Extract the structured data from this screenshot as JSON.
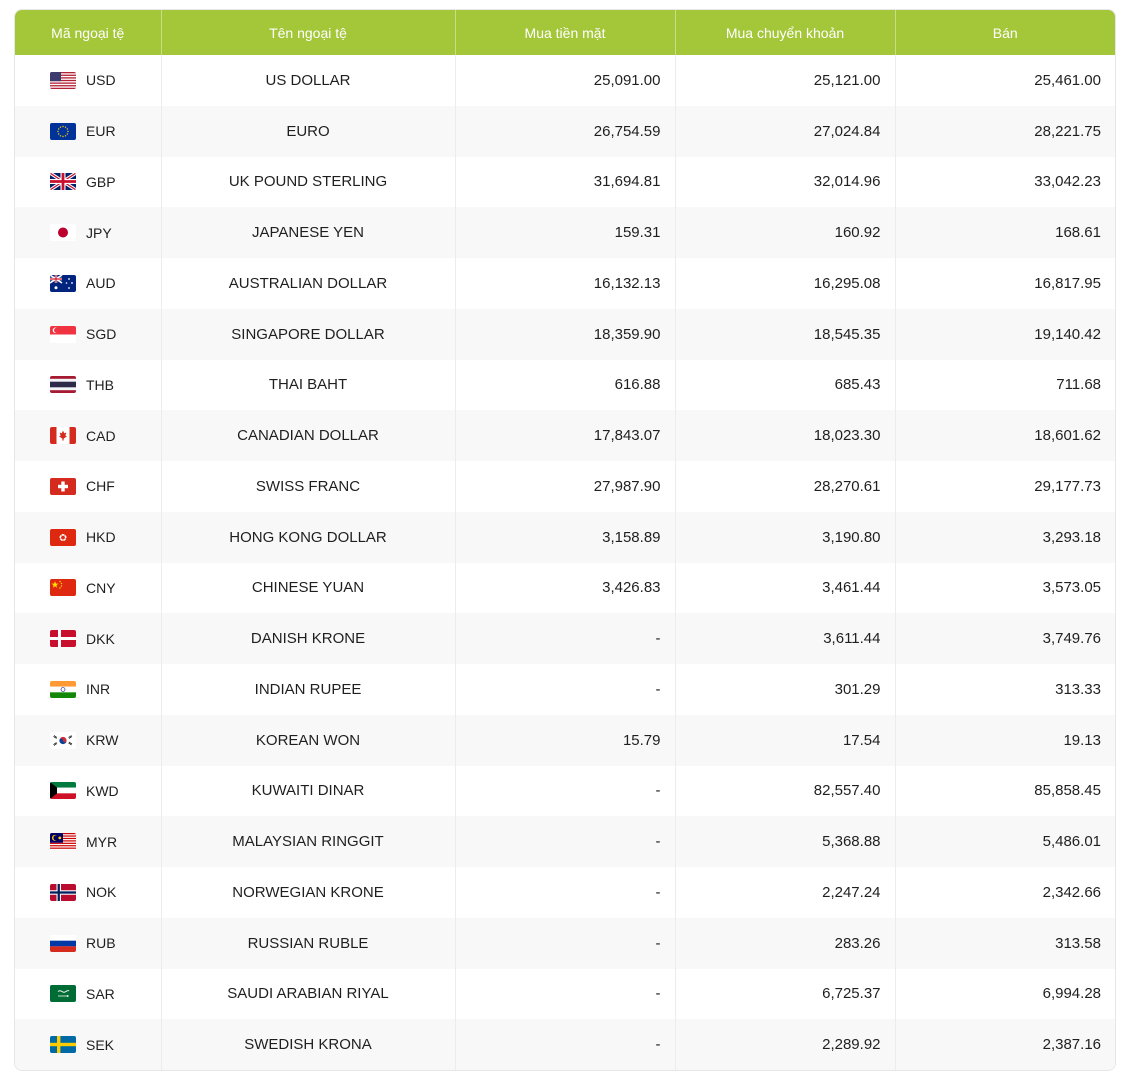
{
  "table": {
    "headers": {
      "code": "Mã ngoại tệ",
      "name": "Tên ngoại tệ",
      "cash_buy": "Mua tiền mặt",
      "transfer_buy": "Mua chuyển khoản",
      "sell": "Bán"
    },
    "rows": [
      {
        "flag": "us-flag-icon",
        "code": "USD",
        "name": "US DOLLAR",
        "cash_buy": "25,091.00",
        "transfer_buy": "25,121.00",
        "sell": "25,461.00"
      },
      {
        "flag": "eu-flag-icon",
        "code": "EUR",
        "name": "EURO",
        "cash_buy": "26,754.59",
        "transfer_buy": "27,024.84",
        "sell": "28,221.75"
      },
      {
        "flag": "uk-flag-icon",
        "code": "GBP",
        "name": "UK POUND STERLING",
        "cash_buy": "31,694.81",
        "transfer_buy": "32,014.96",
        "sell": "33,042.23"
      },
      {
        "flag": "japan-flag-icon",
        "code": "JPY",
        "name": "JAPANESE YEN",
        "cash_buy": "159.31",
        "transfer_buy": "160.92",
        "sell": "168.61"
      },
      {
        "flag": "australia-flag-icon",
        "code": "AUD",
        "name": "AUSTRALIAN DOLLAR",
        "cash_buy": "16,132.13",
        "transfer_buy": "16,295.08",
        "sell": "16,817.95"
      },
      {
        "flag": "singapore-flag-icon",
        "code": "SGD",
        "name": "SINGAPORE DOLLAR",
        "cash_buy": "18,359.90",
        "transfer_buy": "18,545.35",
        "sell": "19,140.42"
      },
      {
        "flag": "thailand-flag-icon",
        "code": "THB",
        "name": "THAI BAHT",
        "cash_buy": "616.88",
        "transfer_buy": "685.43",
        "sell": "711.68"
      },
      {
        "flag": "canada-flag-icon",
        "code": "CAD",
        "name": "CANADIAN DOLLAR",
        "cash_buy": "17,843.07",
        "transfer_buy": "18,023.30",
        "sell": "18,601.62"
      },
      {
        "flag": "switzerland-flag-icon",
        "code": "CHF",
        "name": "SWISS FRANC",
        "cash_buy": "27,987.90",
        "transfer_buy": "28,270.61",
        "sell": "29,177.73"
      },
      {
        "flag": "hong-kong-flag-icon",
        "code": "HKD",
        "name": "HONG KONG DOLLAR",
        "cash_buy": "3,158.89",
        "transfer_buy": "3,190.80",
        "sell": "3,293.18"
      },
      {
        "flag": "china-flag-icon",
        "code": "CNY",
        "name": "CHINESE YUAN",
        "cash_buy": "3,426.83",
        "transfer_buy": "3,461.44",
        "sell": "3,573.05"
      },
      {
        "flag": "denmark-flag-icon",
        "code": "DKK",
        "name": "DANISH KRONE",
        "cash_buy": "-",
        "transfer_buy": "3,611.44",
        "sell": "3,749.76"
      },
      {
        "flag": "india-flag-icon",
        "code": "INR",
        "name": "INDIAN RUPEE",
        "cash_buy": "-",
        "transfer_buy": "301.29",
        "sell": "313.33"
      },
      {
        "flag": "korea-flag-icon",
        "code": "KRW",
        "name": "KOREAN WON",
        "cash_buy": "15.79",
        "transfer_buy": "17.54",
        "sell": "19.13"
      },
      {
        "flag": "kuwait-flag-icon",
        "code": "KWD",
        "name": "KUWAITI DINAR",
        "cash_buy": "-",
        "transfer_buy": "82,557.40",
        "sell": "85,858.45"
      },
      {
        "flag": "malaysia-flag-icon",
        "code": "MYR",
        "name": "MALAYSIAN RINGGIT",
        "cash_buy": "-",
        "transfer_buy": "5,368.88",
        "sell": "5,486.01"
      },
      {
        "flag": "norway-flag-icon",
        "code": "NOK",
        "name": "NORWEGIAN KRONE",
        "cash_buy": "-",
        "transfer_buy": "2,247.24",
        "sell": "2,342.66"
      },
      {
        "flag": "russia-flag-icon",
        "code": "RUB",
        "name": "RUSSIAN RUBLE",
        "cash_buy": "-",
        "transfer_buy": "283.26",
        "sell": "313.58"
      },
      {
        "flag": "saudi-arabia-flag-icon",
        "code": "SAR",
        "name": "SAUDI ARABIAN RIYAL",
        "cash_buy": "-",
        "transfer_buy": "6,725.37",
        "sell": "6,994.28"
      },
      {
        "flag": "sweden-flag-icon",
        "code": "SEK",
        "name": "SWEDISH KRONA",
        "cash_buy": "-",
        "transfer_buy": "2,289.92",
        "sell": "2,387.16"
      }
    ]
  },
  "colors": {
    "header_bg": "#a4c639",
    "header_text": "#ffffff",
    "row_alt_bg": "#f8f8f8"
  }
}
